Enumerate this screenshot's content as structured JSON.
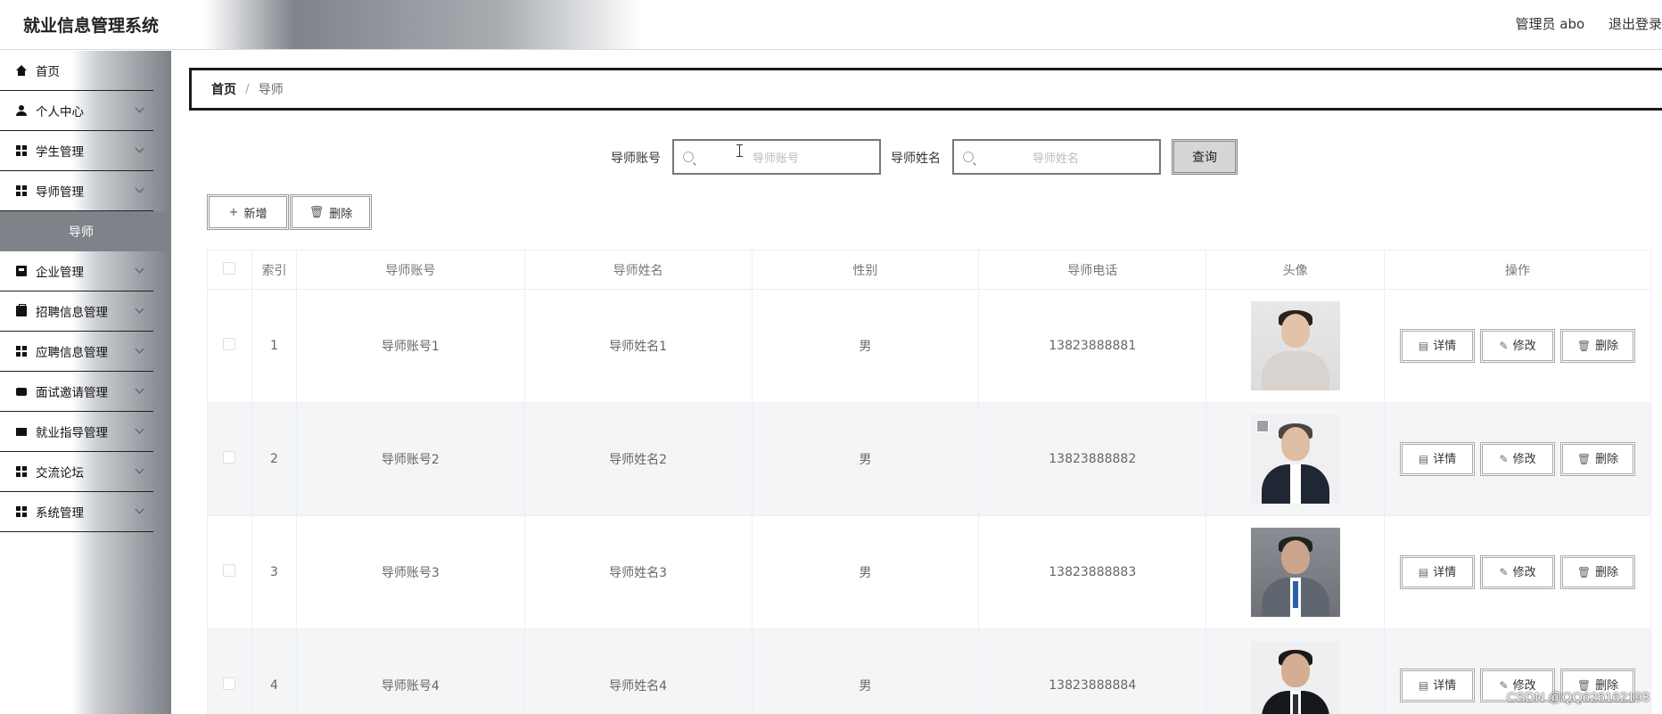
{
  "header": {
    "app_title": "就业信息管理系统",
    "user_label": "管理员 abo",
    "logout_label": "退出登录"
  },
  "sidebar": {
    "items": [
      {
        "label": "首页",
        "icon": "home-icon"
      },
      {
        "label": "个人中心",
        "icon": "user-icon"
      },
      {
        "label": "学生管理",
        "icon": "grid-icon"
      },
      {
        "label": "导师管理",
        "icon": "grid-icon"
      },
      {
        "label": "企业管理",
        "icon": "building-icon"
      },
      {
        "label": "招聘信息管理",
        "icon": "briefcase-icon"
      },
      {
        "label": "应聘信息管理",
        "icon": "grid-icon"
      },
      {
        "label": "面试邀请管理",
        "icon": "chat-icon"
      },
      {
        "label": "就业指导管理",
        "icon": "monitor-icon"
      },
      {
        "label": "交流论坛",
        "icon": "grid-icon"
      },
      {
        "label": "系统管理",
        "icon": "grid-icon"
      }
    ],
    "active_sub": "导师"
  },
  "breadcrumb": {
    "home": "首页",
    "separator": "/",
    "current": "导师"
  },
  "search": {
    "account_label": "导师账号",
    "account_placeholder": "导师账号",
    "name_label": "导师姓名",
    "name_placeholder": "导师姓名",
    "query_button": "查询"
  },
  "actions": {
    "add": "新增",
    "delete": "删除"
  },
  "table": {
    "headers": [
      "索引",
      "导师账号",
      "导师姓名",
      "性别",
      "导师电话",
      "头像",
      "操作"
    ],
    "rows": [
      {
        "index": "1",
        "account": "导师账号1",
        "name": "导师姓名1",
        "gender": "男",
        "phone": "13823888881"
      },
      {
        "index": "2",
        "account": "导师账号2",
        "name": "导师姓名2",
        "gender": "男",
        "phone": "13823888882"
      },
      {
        "index": "3",
        "account": "导师账号3",
        "name": "导师姓名3",
        "gender": "男",
        "phone": "13823888883"
      },
      {
        "index": "4",
        "account": "导师账号4",
        "name": "导师姓名4",
        "gender": "男",
        "phone": "13823888884"
      }
    ],
    "row_actions": {
      "detail": "详情",
      "edit": "修改",
      "delete": "删除"
    }
  },
  "watermark": "CSDN @QQ626162193"
}
